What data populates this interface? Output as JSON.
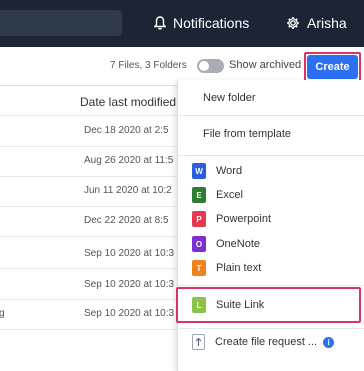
{
  "header": {
    "notifications_label": "Notifications",
    "user_name": "Arisha",
    "bell_icon": "bell-icon",
    "gear_icon": "gear-icon"
  },
  "toolbar": {
    "summary": "7 Files, 3 Folders",
    "show_archived_label": "Show archived",
    "show_archived_on": false,
    "create_label": "Create"
  },
  "table": {
    "column_header": "Date last modified",
    "rows": [
      {
        "date": "Dec 18 2020 at 2:5"
      },
      {
        "date": "Aug 26 2020 at 11:5"
      },
      {
        "date": "Jun 11 2020 at 10:2"
      },
      {
        "date": "Dec 22 2020 at 8:5"
      },
      {
        "date": "Sep 10 2020 at 10:3"
      },
      {
        "date": "Sep 10 2020 at 10:3"
      },
      {
        "date": "Sep 10 2020 at 10:3",
        "left_fragment": "g"
      }
    ]
  },
  "create_menu": {
    "new_folder": "New folder",
    "file_from_template": "File from template",
    "file_types": [
      {
        "label": "Word",
        "icon_letter": "W",
        "color": "#2b5fd9"
      },
      {
        "label": "Excel",
        "icon_letter": "E",
        "color": "#2e7d32"
      },
      {
        "label": "Powerpoint",
        "icon_letter": "P",
        "color": "#e53950"
      },
      {
        "label": "OneNote",
        "icon_letter": "O",
        "color": "#7b2fd1"
      },
      {
        "label": "Plain text",
        "icon_letter": "T",
        "color": "#f0821e"
      }
    ],
    "suite_link": {
      "label": "Suite Link",
      "icon_letter": "L",
      "color": "#8bc34a"
    },
    "create_file_request": "Create file request ...",
    "info_badge": "i"
  },
  "colors": {
    "topbar": "#1b2536",
    "accent": "#2b6ff2",
    "highlight": "#d6336c"
  }
}
